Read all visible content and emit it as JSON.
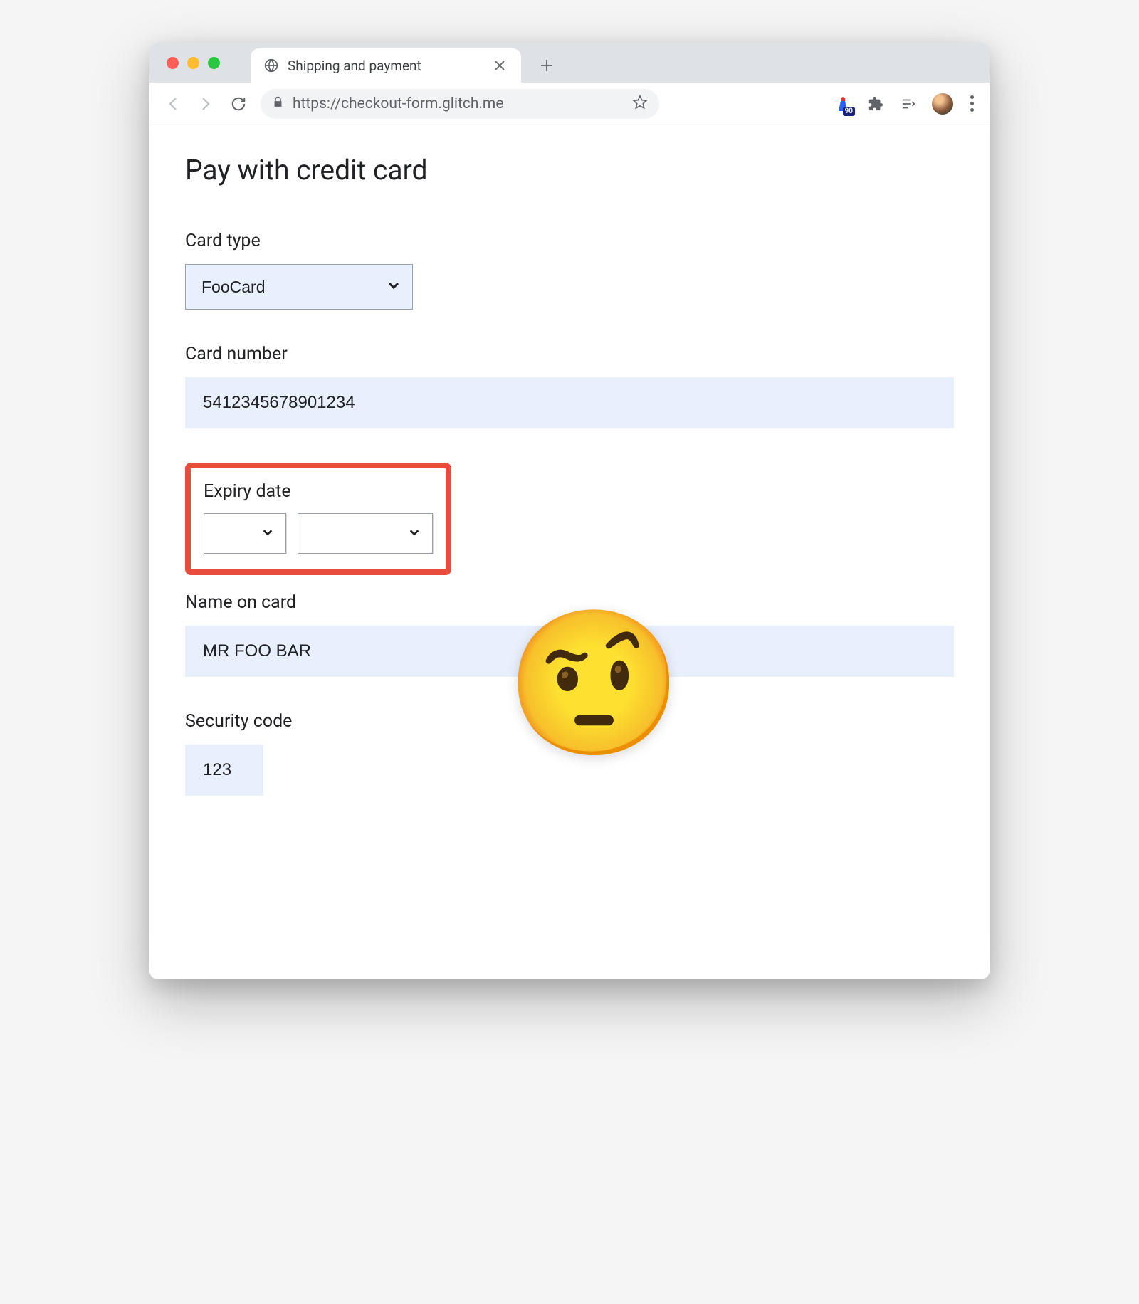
{
  "browser": {
    "tab_title": "Shipping and payment",
    "url": "https://checkout-form.glitch.me",
    "extension_badge": "90"
  },
  "page": {
    "heading": "Pay with credit card",
    "card_type": {
      "label": "Card type",
      "value": "FooCard"
    },
    "card_number": {
      "label": "Card number",
      "value": "5412345678901234"
    },
    "expiry": {
      "label": "Expiry date",
      "month": "",
      "year": ""
    },
    "name_on_card": {
      "label": "Name on card",
      "value": "MR FOO BAR"
    },
    "security_code": {
      "label": "Security code",
      "value": "123"
    },
    "emoji": "🤨"
  }
}
